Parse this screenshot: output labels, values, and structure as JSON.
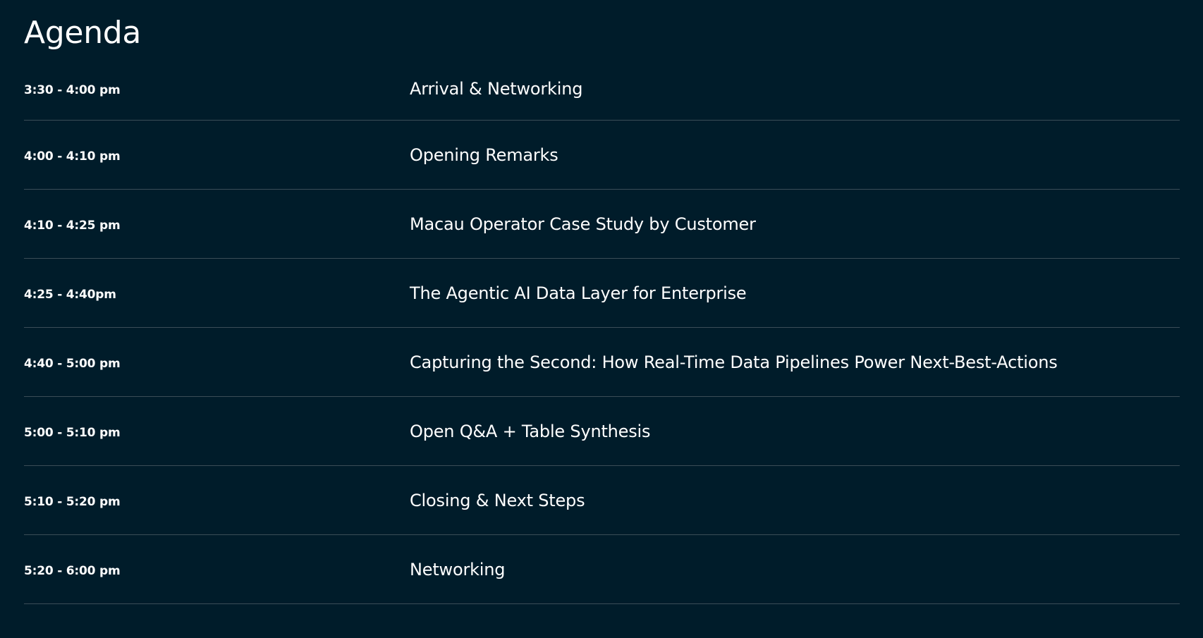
{
  "page": {
    "title": "Agenda",
    "background_color": "#001c2a",
    "text_color": "#ffffff",
    "divider_color": "#3b4d57"
  },
  "agenda": [
    {
      "time": "3:30 - 4:00 pm",
      "topic": "Arrival & Networking"
    },
    {
      "time": "4:00 - 4:10 pm",
      "topic": "Opening Remarks"
    },
    {
      "time": "4:10 - 4:25 pm",
      "topic": "Macau Operator Case Study by Customer"
    },
    {
      "time": "4:25 - 4:40pm",
      "topic": "The Agentic AI Data Layer for Enterprise"
    },
    {
      "time": "4:40 - 5:00 pm",
      "topic": "Capturing the Second: How Real-Time Data Pipelines Power Next-Best-Actions"
    },
    {
      "time": "5:00 - 5:10 pm",
      "topic": "Open Q&A + Table Synthesis"
    },
    {
      "time": "5:10 - 5:20 pm",
      "topic": "Closing & Next Steps"
    },
    {
      "time": "5:20 - 6:00 pm",
      "topic": "Networking"
    }
  ]
}
